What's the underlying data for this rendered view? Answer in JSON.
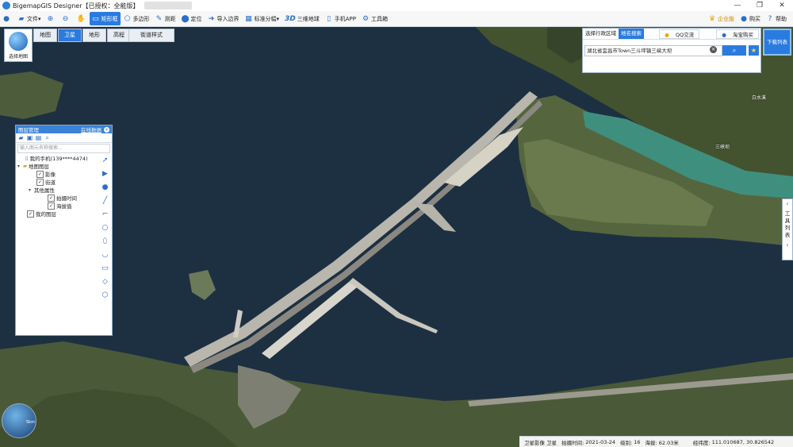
{
  "app": {
    "title": "BigemapGIS Designer【已授权：全能版】"
  },
  "window_controls": [
    "—",
    "❐",
    "✕"
  ],
  "toolbar": {
    "file": "文件",
    "tools": [
      {
        "label": "",
        "icon": "zoom-in-icon"
      },
      {
        "label": "",
        "icon": "zoom-out-icon"
      },
      {
        "label": "",
        "icon": "pan-hand-icon"
      },
      {
        "label": "矩形框",
        "icon": "rectangle-select-icon",
        "active": true
      },
      {
        "label": "多边形",
        "icon": "polygon-icon"
      },
      {
        "label": "测距",
        "icon": "ruler-icon"
      },
      {
        "label": "定位",
        "icon": "location-pin-icon"
      },
      {
        "label": "导入边界",
        "icon": "import-arrow-icon"
      },
      {
        "label": "标准分幅",
        "icon": "grid-icon"
      },
      {
        "label": "三维地球",
        "icon": "3d-icon"
      },
      {
        "label": "手机APP",
        "icon": "phone-icon"
      },
      {
        "label": "工具箱",
        "icon": "gear-icon"
      }
    ],
    "right": [
      {
        "label": "企业版",
        "icon": "crown-icon"
      },
      {
        "label": "购买",
        "icon": "vip-icon"
      },
      {
        "label": "帮助",
        "icon": "help-icon"
      }
    ]
  },
  "choose_map": {
    "label": "选择地图"
  },
  "map_tabs": [
    {
      "label": "地图",
      "active": false
    },
    {
      "label": "卫星",
      "active": true
    },
    {
      "label": "地形",
      "active": false
    },
    {
      "label": "高程",
      "active": false
    }
  ],
  "street_style": "街道样式",
  "layer_panel": {
    "title": "图层管理",
    "online_label": "在线数据",
    "search_placeholder": "输入图元名称搜索...",
    "tree": [
      {
        "label": "我的手机(139****4474)",
        "level": 1,
        "toggle": "",
        "checkbox": false,
        "icon": "phone"
      },
      {
        "label": "地图图层",
        "level": 0,
        "toggle": "▾",
        "checkbox": false,
        "icon": "folder"
      },
      {
        "label": "影像",
        "level": 2,
        "toggle": "",
        "checkbox": true
      },
      {
        "label": "街道",
        "level": 2,
        "toggle": "",
        "checkbox": true
      },
      {
        "label": "其他属性",
        "level": 1,
        "toggle": "▾",
        "checkbox": false
      },
      {
        "label": "拍摄时间",
        "level": 3,
        "toggle": "",
        "checkbox": true
      },
      {
        "label": "海拔值",
        "level": 3,
        "toggle": "",
        "checkbox": true
      },
      {
        "label": "我的图层",
        "level": 0,
        "toggle": "",
        "checkbox": true
      }
    ]
  },
  "region_panel": {
    "tabs": [
      "选择行政区域",
      "地名搜索"
    ],
    "active_tab": 1,
    "qq_label": "QQ交流",
    "taobao_label": "淘宝购买",
    "search_value": "湖北省宜昌市Town三斗坪镇三峡大坝"
  },
  "download_label": "下载列表",
  "tool_panel_label": "工具列表",
  "map_labels": [
    "三峡坝",
    "白水溪"
  ],
  "minimap_scale": "5km",
  "status": {
    "layer": "卫星影像 卫星",
    "shot_time_label": "拍摄时间:",
    "shot_time": "2021-03-24",
    "zoom_label": "级别:",
    "zoom": "16",
    "elev_label": "海拔:",
    "elev": "62.03米",
    "coord_label": "经纬度:",
    "coord": "111.010687, 30.826542"
  },
  "colors": {
    "accent": "#2a7be0",
    "water": "#1c2e40",
    "land": "#4d5e3a"
  }
}
